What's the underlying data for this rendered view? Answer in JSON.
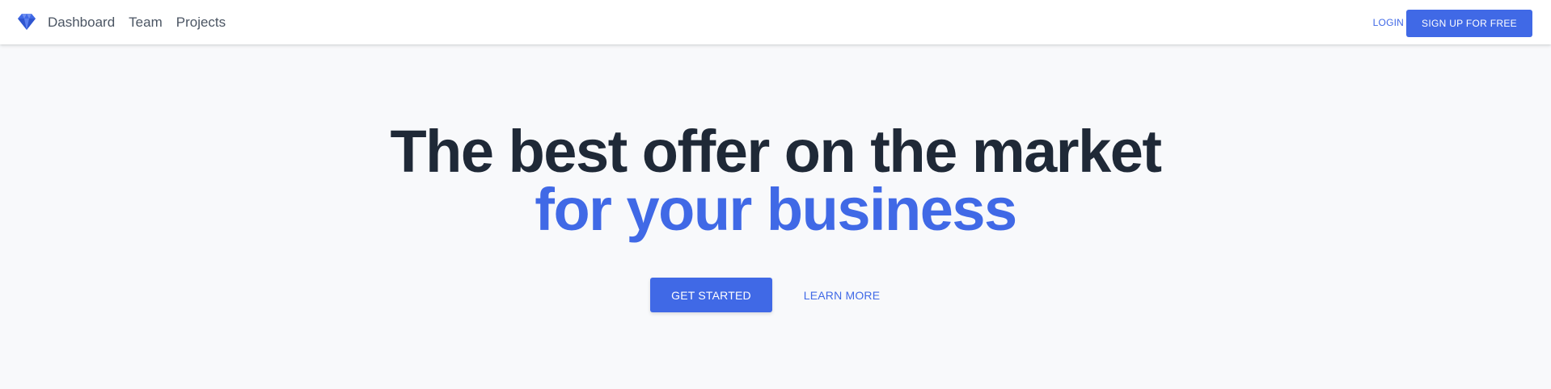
{
  "colors": {
    "accent": "#4069e6",
    "heading": "#1f2937",
    "nav_text": "#4b5563",
    "background": "#f8f9fb"
  },
  "nav": {
    "logo_icon": "diamond-icon",
    "links": [
      "Dashboard",
      "Team",
      "Projects"
    ],
    "login_label": "LOGIN",
    "signup_label": "SIGN UP FOR FREE"
  },
  "hero": {
    "title_line1": "The best offer on the market",
    "title_line2": "for your business",
    "primary_cta": "GET STARTED",
    "secondary_cta": "LEARN MORE"
  }
}
